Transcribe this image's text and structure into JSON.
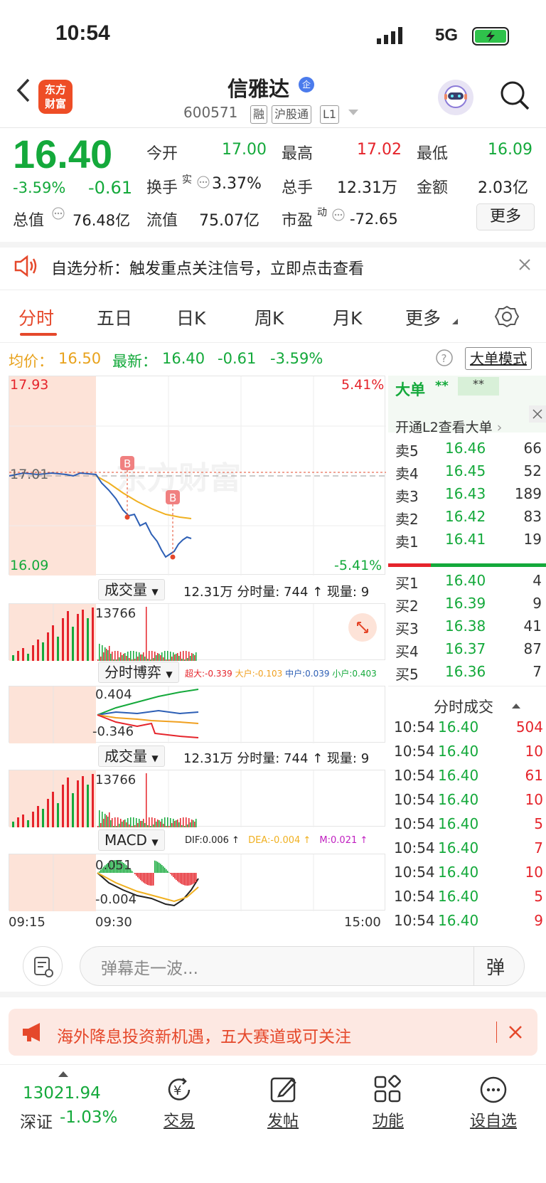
{
  "status": {
    "time": "10:54",
    "network": "5G"
  },
  "header": {
    "logo": "东方\n财富",
    "name": "信雅达",
    "badge": "企",
    "code": "600571",
    "tags": [
      "融",
      "沪股通",
      "L1"
    ]
  },
  "quote": {
    "price": "16.40",
    "pct": "-3.59%",
    "chg": "-0.61",
    "rows": [
      [
        {
          "l": "今开",
          "v": "17.00",
          "c": "green"
        },
        {
          "l": "最高",
          "v": "17.02",
          "c": "red"
        },
        {
          "l": "最低",
          "v": "16.09",
          "c": "green"
        }
      ],
      [
        {
          "l": "换手",
          "v": "3.37%",
          "c": "dark"
        },
        {
          "l": "总手",
          "v": "12.31万",
          "c": "dark"
        },
        {
          "l": "金额",
          "v": "2.03亿",
          "c": "dark"
        }
      ],
      [
        {
          "l": "总值",
          "v": "76.48亿",
          "c": "dark"
        },
        {
          "l": "流值",
          "v": "75.07亿",
          "c": "dark"
        },
        {
          "l": "市盈",
          "v": "-72.65",
          "c": "dark"
        }
      ]
    ],
    "turnover_sup": "实",
    "pe_sup": "动",
    "more": "更多"
  },
  "notice": {
    "text": "自选分析：触发重点关注信号，立即点击查看"
  },
  "tabs": [
    "分时",
    "五日",
    "日K",
    "周K",
    "月K",
    "更多"
  ],
  "infobar": {
    "avg_label": "均价：",
    "avg": "16.50",
    "latest_label": "最新：",
    "latest": "16.40",
    "chg": "-0.61",
    "pct": "-3.59%",
    "mode": "大单模式"
  },
  "chart": {
    "ymax": "17.93",
    "ymid": "17.01",
    "ymin": "16.09",
    "pmax": "5.41%",
    "pmin": "-5.41%",
    "watermark": "东方财富",
    "buy_marker": "B",
    "times": [
      "09:15",
      "09:30",
      "15:00"
    ]
  },
  "vol1": {
    "label": "成交量",
    "summary": "12.31万 分时量: 744 ↑ 现量: 9",
    "peak": "13766"
  },
  "game": {
    "label": "分时博弈",
    "items": [
      {
        "t": "超大:-0.339",
        "c": "#e5242b"
      },
      {
        "t": "大户:-0.103",
        "c": "#f0a020"
      },
      {
        "t": "中户:0.039",
        "c": "#2d5fb5"
      },
      {
        "t": "小户:0.403",
        "c": "#14a93b"
      }
    ],
    "top": "0.404",
    "bottom": "-0.346"
  },
  "vol2": {
    "label": "成交量",
    "summary": "12.31万 分时量: 744 ↑ 现量: 9",
    "peak": "13766"
  },
  "macd": {
    "label": "MACD",
    "dif": "DIF:0.006 ↑",
    "dea": "DEA:-0.004 ↑",
    "m": "M:0.021 ↑",
    "top": "0.051",
    "bottom": "-0.004"
  },
  "bigorder": {
    "title": "大单",
    "stars1": "**",
    "stars2": "**",
    "open_l2": "开通L2查看大单"
  },
  "orderbook": {
    "sell": [
      {
        "l": "卖5",
        "p": "16.46",
        "q": "66"
      },
      {
        "l": "卖4",
        "p": "16.45",
        "q": "52"
      },
      {
        "l": "卖3",
        "p": "16.43",
        "q": "189"
      },
      {
        "l": "卖2",
        "p": "16.42",
        "q": "83"
      },
      {
        "l": "卖1",
        "p": "16.41",
        "q": "19"
      }
    ],
    "buy": [
      {
        "l": "买1",
        "p": "16.40",
        "q": "4"
      },
      {
        "l": "买2",
        "p": "16.39",
        "q": "9"
      },
      {
        "l": "买3",
        "p": "16.38",
        "q": "41"
      },
      {
        "l": "买4",
        "p": "16.37",
        "q": "87"
      },
      {
        "l": "买5",
        "p": "16.36",
        "q": "7"
      }
    ]
  },
  "trades": {
    "title": "分时成交",
    "rows": [
      {
        "t": "10:54",
        "p": "16.40",
        "q": "504"
      },
      {
        "t": "10:54",
        "p": "16.40",
        "q": "10"
      },
      {
        "t": "10:54",
        "p": "16.40",
        "q": "61"
      },
      {
        "t": "10:54",
        "p": "16.40",
        "q": "10"
      },
      {
        "t": "10:54",
        "p": "16.40",
        "q": "5"
      },
      {
        "t": "10:54",
        "p": "16.40",
        "q": "7"
      },
      {
        "t": "10:54",
        "p": "16.40",
        "q": "10"
      },
      {
        "t": "10:54",
        "p": "16.40",
        "q": "5"
      },
      {
        "t": "10:54",
        "p": "16.40",
        "q": "9"
      }
    ]
  },
  "danmu": {
    "placeholder": "弹幕走一波...",
    "btn": "弹"
  },
  "ad": {
    "text": "海外降息投资新机遇，五大赛道或可关注"
  },
  "bottom": {
    "index": "13021.94",
    "index_name": "深证",
    "index_pct": "-1.03%",
    "items": [
      "交易",
      "发帖",
      "功能",
      "设自选"
    ]
  },
  "colors": {
    "red": "#e5242b",
    "green": "#14a93b",
    "accent": "#e5482b"
  }
}
